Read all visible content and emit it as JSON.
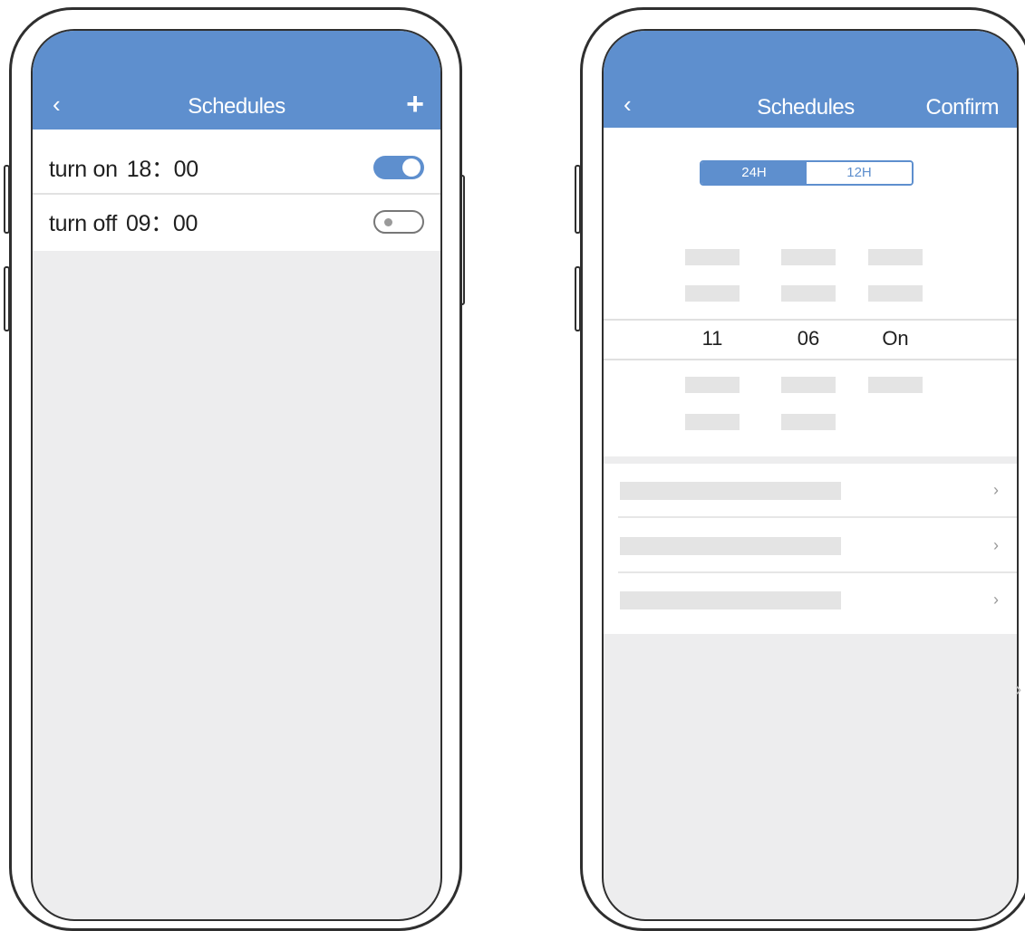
{
  "left_phone": {
    "header": {
      "title": "Schedules",
      "back_icon": "‹",
      "add_icon": "+"
    },
    "schedules": [
      {
        "action": "turn on",
        "time": "18：00",
        "enabled": true
      },
      {
        "action": "turn off",
        "time": "09：00",
        "enabled": false
      }
    ]
  },
  "right_phone": {
    "header": {
      "title": "Schedules",
      "back_icon": "‹",
      "confirm_label": "Confirm"
    },
    "format_toggle": {
      "options": [
        "24H",
        "12H"
      ],
      "selected": "24H"
    },
    "picker": {
      "hour": "11",
      "minute": "06",
      "state": "On"
    },
    "option_rows": [
      {
        "chevron": "›"
      },
      {
        "chevron": "›"
      },
      {
        "chevron": "›"
      }
    ]
  },
  "edge_chevron": "›",
  "colors": {
    "accent": "#5e8fce",
    "background": "#ededee",
    "frame": "#2f2f2f"
  }
}
